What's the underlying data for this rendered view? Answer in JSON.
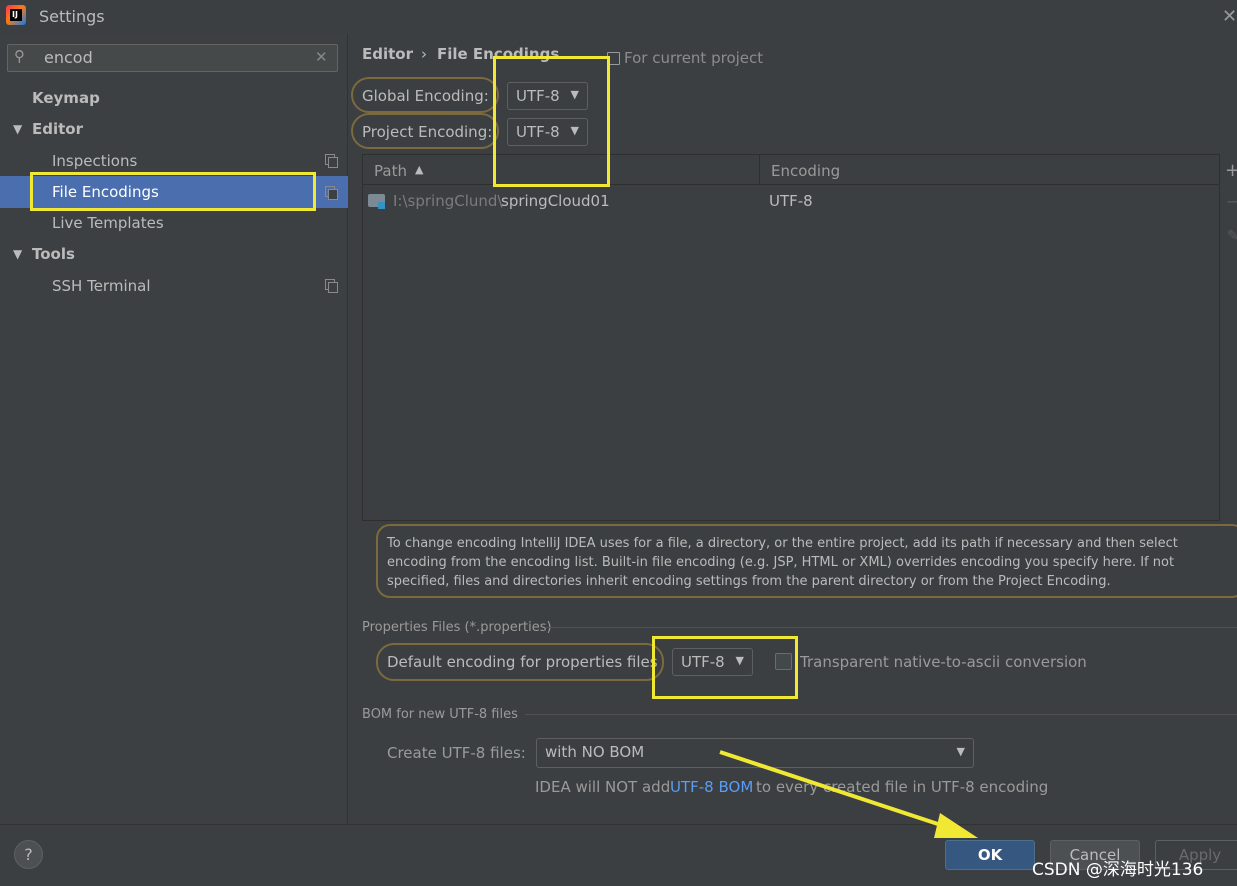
{
  "window": {
    "title": "Settings"
  },
  "search": {
    "value": "encod"
  },
  "sidebar": {
    "items": [
      {
        "label": "Keymap"
      },
      {
        "label": "Editor"
      },
      {
        "label": "Inspections"
      },
      {
        "label": "File Encodings"
      },
      {
        "label": "Live Templates"
      },
      {
        "label": "Tools"
      },
      {
        "label": "SSH Terminal"
      }
    ]
  },
  "breadcrumb": {
    "parent": "Editor",
    "separator": "›",
    "current": "File Encodings",
    "scope": "For current project"
  },
  "encodings": {
    "global_label": "Global Encoding:",
    "global_value": "UTF-8",
    "project_label": "Project Encoding:",
    "project_value": "UTF-8"
  },
  "table": {
    "columns": [
      "Path",
      "Encoding"
    ],
    "rows": [
      {
        "path_prefix": "I:\\springClund\\",
        "path_name": "springCloud01",
        "encoding": "UTF-8"
      }
    ]
  },
  "help_text": "To change encoding IntelliJ IDEA uses for a file, a directory, or the entire project, add its path if necessary and then select encoding from the encoding list. Built-in file encoding (e.g. JSP, HTML or XML) overrides encoding you specify here. If not specified, files and directories inherit encoding settings from the parent directory or from the Project Encoding.",
  "properties": {
    "section_title": "Properties Files (*.properties)",
    "default_label": "Default encoding for properties files",
    "default_value": "UTF-8",
    "native_label": "Transparent native-to-ascii conversion",
    "native_checked": false
  },
  "bom": {
    "section_title": "BOM for new UTF-8 files",
    "create_label": "Create UTF-8 files:",
    "create_value": "with NO BOM",
    "note_a": "IDEA will NOT add",
    "note_link": "UTF-8 BOM",
    "note_b": "to every created file in UTF-8 encoding"
  },
  "footer": {
    "help": "?",
    "ok": "OK",
    "cancel": "Cancel",
    "apply": "Apply"
  },
  "watermark": "CSDN @深海时光136",
  "colors": {
    "accent": "#4b6eaf",
    "highlight": "#f0e832",
    "link": "#589df6",
    "ok_button": "#365880"
  }
}
